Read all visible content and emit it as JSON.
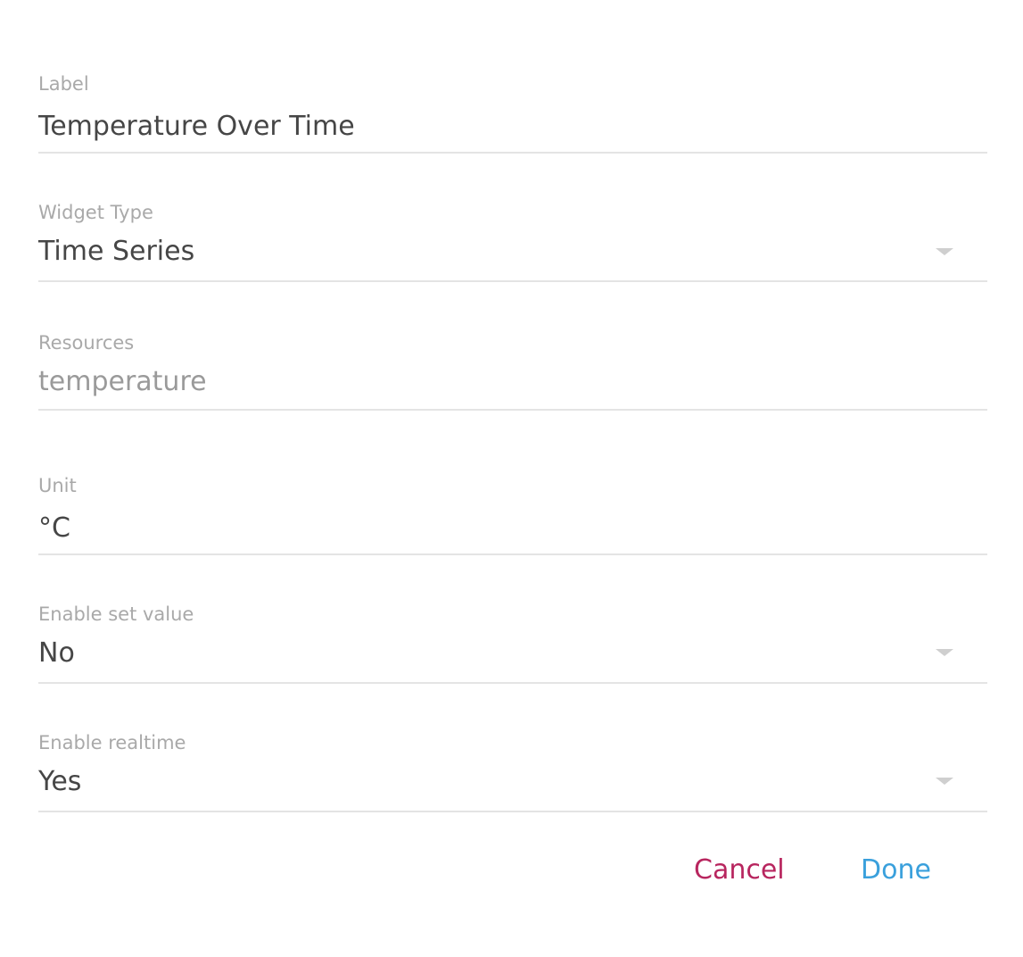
{
  "fields": {
    "label": {
      "label": "Label",
      "value": "Temperature Over Time"
    },
    "widget_type": {
      "label": "Widget Type",
      "value": "Time Series"
    },
    "resources": {
      "label": "Resources",
      "value": "temperature"
    },
    "unit": {
      "label": "Unit",
      "value": "°C"
    },
    "enable_set_value": {
      "label": "Enable set value",
      "value": "No"
    },
    "enable_realtime": {
      "label": "Enable realtime",
      "value": "Yes"
    }
  },
  "actions": {
    "cancel": "Cancel",
    "done": "Done"
  },
  "colors": {
    "cancel": "#b8265f",
    "done": "#3aa0dc",
    "label": "#a9a9a9",
    "value": "#464646",
    "divider": "#e4e4e4"
  },
  "icons": {
    "dropdown": "chevron-down-icon"
  }
}
